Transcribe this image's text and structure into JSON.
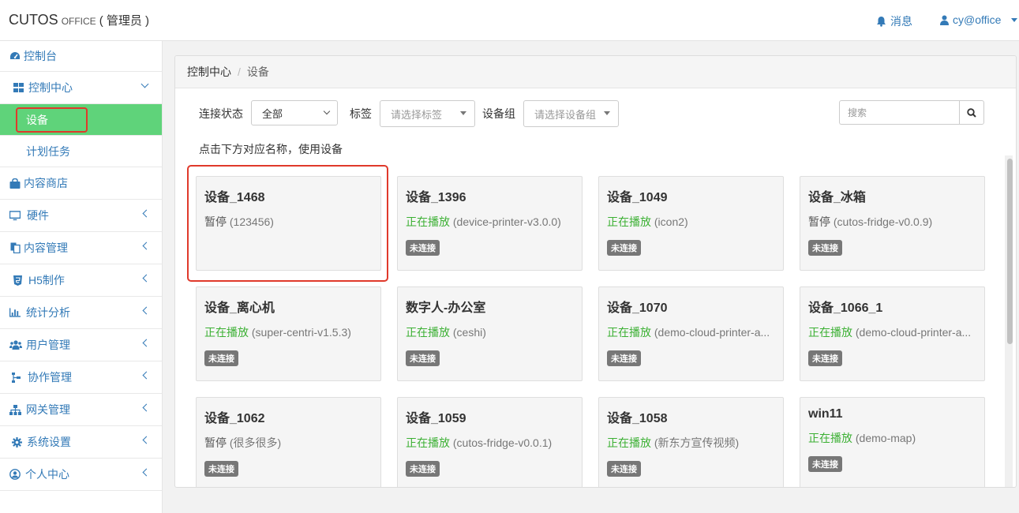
{
  "header": {
    "brand": "CUTOS",
    "brand_sub": "OFFICE",
    "brand_role": "( 管理员 )",
    "messages_label": "消息",
    "user_label": "cy@office"
  },
  "sidebar": {
    "items": [
      {
        "label": "控制台",
        "icon": "dashboard-icon"
      },
      {
        "label": "控制中心",
        "icon": "grid-icon"
      },
      {
        "label": "设备"
      },
      {
        "label": "计划任务"
      },
      {
        "label": "内容商店",
        "icon": "shopping-bag-icon"
      },
      {
        "label": "硬件",
        "icon": "monitor-icon"
      },
      {
        "label": "内容管理",
        "icon": "files-icon"
      },
      {
        "label": "H5制作",
        "icon": "html5-icon"
      },
      {
        "label": "统计分析",
        "icon": "bar-chart-icon"
      },
      {
        "label": "用户管理",
        "icon": "users-icon"
      },
      {
        "label": "协作管理",
        "icon": "flow-icon"
      },
      {
        "label": "网关管理",
        "icon": "sitemap-icon"
      },
      {
        "label": "系统设置",
        "icon": "gear-icon"
      },
      {
        "label": "个人中心",
        "icon": "user-circle-icon"
      }
    ]
  },
  "breadcrumb": {
    "root": "控制中心",
    "sep": "/",
    "current": "设备"
  },
  "filters": {
    "connection_label": "连接状态",
    "connection_value": "全部",
    "tag_label": "标签",
    "tag_placeholder": "请选择标签",
    "group_label": "设备组",
    "group_placeholder": "请选择设备组",
    "search_placeholder": "搜索"
  },
  "hint": "点击下方对应名称，使用设备",
  "devices": [
    {
      "name": "设备_1468",
      "status": "暂停",
      "detail": "(123456)",
      "badge": ""
    },
    {
      "name": "设备_1396",
      "status": "正在播放",
      "detail": "(device-printer-v3.0.0)",
      "badge": "未连接"
    },
    {
      "name": "设备_1049",
      "status": "正在播放",
      "detail": "(icon2)",
      "badge": "未连接"
    },
    {
      "name": "设备_冰箱",
      "status": "暂停",
      "detail": "(cutos-fridge-v0.0.9)",
      "badge": "未连接"
    },
    {
      "name": "设备_离心机",
      "status": "正在播放",
      "detail": "(super-centri-v1.5.3)",
      "badge": "未连接"
    },
    {
      "name": "数字人-办公室",
      "status": "正在播放",
      "detail": "(ceshi)",
      "badge": "未连接"
    },
    {
      "name": "设备_1070",
      "status": "正在播放",
      "detail": "(demo-cloud-printer-a...",
      "badge": "未连接"
    },
    {
      "name": "设备_1066_1",
      "status": "正在播放",
      "detail": "(demo-cloud-printer-a...",
      "badge": "未连接"
    },
    {
      "name": "设备_1062",
      "status": "暂停",
      "detail": "(很多很多)",
      "badge": "未连接"
    },
    {
      "name": "设备_1059",
      "status": "正在播放",
      "detail": "(cutos-fridge-v0.0.1)",
      "badge": "未连接"
    },
    {
      "name": "设备_1058",
      "status": "正在播放",
      "detail": "(新东方宣传视频)",
      "badge": "未连接"
    },
    {
      "name": "win11",
      "status": "正在播放",
      "detail": "(demo-map)",
      "badge": "未连接"
    }
  ],
  "colors": {
    "link": "#337ab7",
    "active_menu": "#5fd37a",
    "playing": "#3cb034",
    "highlight": "#e0392b"
  }
}
